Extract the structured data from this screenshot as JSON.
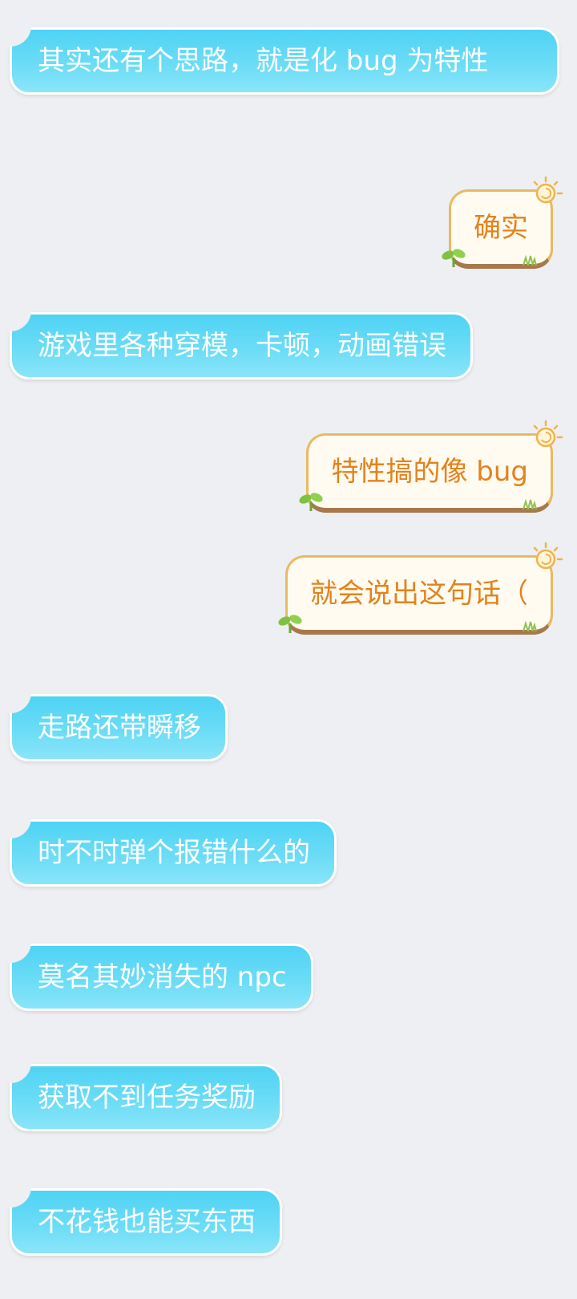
{
  "messages": [
    {
      "side": "received",
      "text": "其实还有个思路，就是化 bug 为特性"
    },
    {
      "side": "sent",
      "text": "确实"
    },
    {
      "side": "received",
      "text": "游戏里各种穿模，卡顿，动画错误"
    },
    {
      "side": "sent",
      "text": "特性搞的像 bug"
    },
    {
      "side": "sent",
      "text": "就会说出这句话（"
    },
    {
      "side": "received",
      "text": "走路还带瞬移"
    },
    {
      "side": "received",
      "text": "时不时弹个报错什么的"
    },
    {
      "side": "received",
      "text": "莫名其妙消失的 npc"
    },
    {
      "side": "received",
      "text": "获取不到任务奖励"
    },
    {
      "side": "received",
      "text": "不花钱也能买东西"
    }
  ],
  "colors": {
    "background": "#eeeff3",
    "received_bubble": "#5fd8f5",
    "received_text": "#ffffff",
    "sent_bubble": "#fffbf0",
    "sent_text": "#e3821c",
    "sent_border": "#e9b964"
  },
  "icons": [
    "sun-decoration-icon",
    "sprout-decoration-icon",
    "grass-decoration-icon"
  ]
}
